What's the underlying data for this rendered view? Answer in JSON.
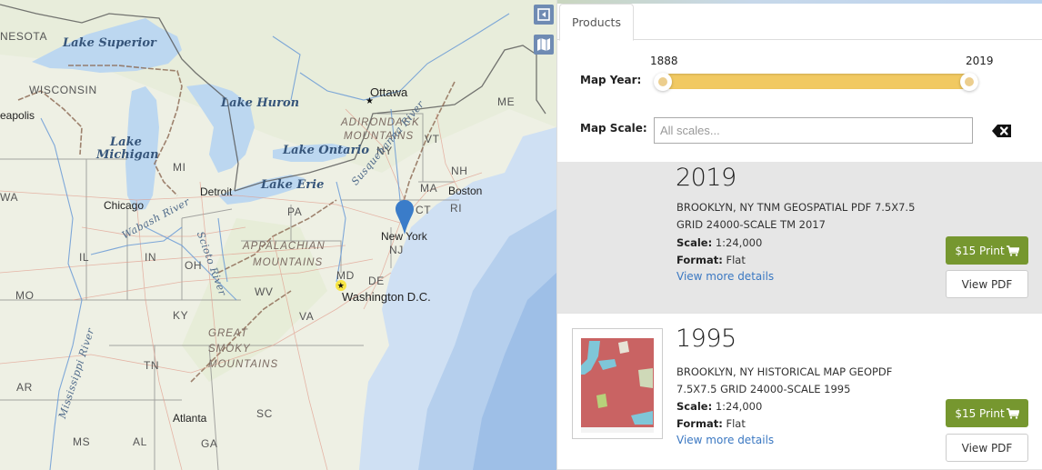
{
  "map": {
    "controls": {
      "collapse_icon": "collapse-panel-icon",
      "basemap_icon": "basemap-icon"
    },
    "labels": {
      "lakes": [
        "Lake Superior",
        "Lake Huron",
        "Lake Michigan",
        "Lake Ontario",
        "Lake Erie"
      ],
      "lake_michigan_line1": "Lake",
      "lake_michigan_line2": "Michigan",
      "states": [
        "NESOTA",
        "WISCONSIN",
        "WA",
        "MI",
        "IL",
        "IN",
        "OH",
        "MO",
        "KY",
        "WV",
        "VA",
        "TN",
        "AR",
        "MS",
        "AL",
        "GA",
        "SC",
        "PA",
        "NY",
        "NJ",
        "MD",
        "DE",
        "VT",
        "NH",
        "MA",
        "CT",
        "RI",
        "ME"
      ],
      "cities": [
        "eapolis",
        "Chicago",
        "Detroit",
        "Ottawa",
        "Boston",
        "New York",
        "Washington D.C.",
        "Atlanta"
      ],
      "mountains": {
        "adirondack_1": "ADIRONDACK",
        "adirondack_2": "MOUNTAINS",
        "appalachian_1": "APPALACHIAN",
        "appalachian_2": "MOUNTAINS",
        "smoky_1": "GREAT",
        "smoky_2": "SMOKY",
        "smoky_3": "MOUNTAINS"
      },
      "rivers": [
        "Wabash River",
        "Scioto River",
        "Mississippi River",
        "Susquehanna River"
      ]
    },
    "marker": {
      "location": "New York",
      "color": "#3a7cc9"
    }
  },
  "panel": {
    "tabs": [
      {
        "label": "Products",
        "active": true
      }
    ],
    "filters": {
      "year_label": "Map Year:",
      "year_min": "1888",
      "year_max": "2019",
      "year_range_fraction": [
        0.0,
        1.0
      ],
      "scale_label": "Map Scale:",
      "scale_placeholder": "All scales...",
      "scale_value": "",
      "clear_icon": "clear-backspace-icon"
    },
    "products": [
      {
        "year": "2019",
        "title": "BROOKLYN, NY TNM GEOSPATIAL PDF 7.5X7.5 GRID 24000-SCALE TM 2017",
        "scale_label": "Scale:",
        "scale": "1:24,000",
        "format_label": "Format:",
        "format": "Flat",
        "details_link": "View more details",
        "print_button": "$15 Print",
        "pdf_button": "View PDF",
        "has_thumbnail": false,
        "selected": true
      },
      {
        "year": "1995",
        "title": "BROOKLYN, NY HISTORICAL MAP GEOPDF 7.5X7.5 GRID 24000-SCALE 1995",
        "scale_label": "Scale:",
        "scale": "1:24,000",
        "format_label": "Format:",
        "format": "Flat",
        "details_link": "View more details",
        "print_button": "$15 Print",
        "pdf_button": "View PDF",
        "has_thumbnail": true,
        "selected": false
      }
    ],
    "colors": {
      "slider_fill": "#f1c962",
      "print_button": "#76972f",
      "link": "#3b78c2",
      "selected_row": "#e6e6e6"
    }
  }
}
